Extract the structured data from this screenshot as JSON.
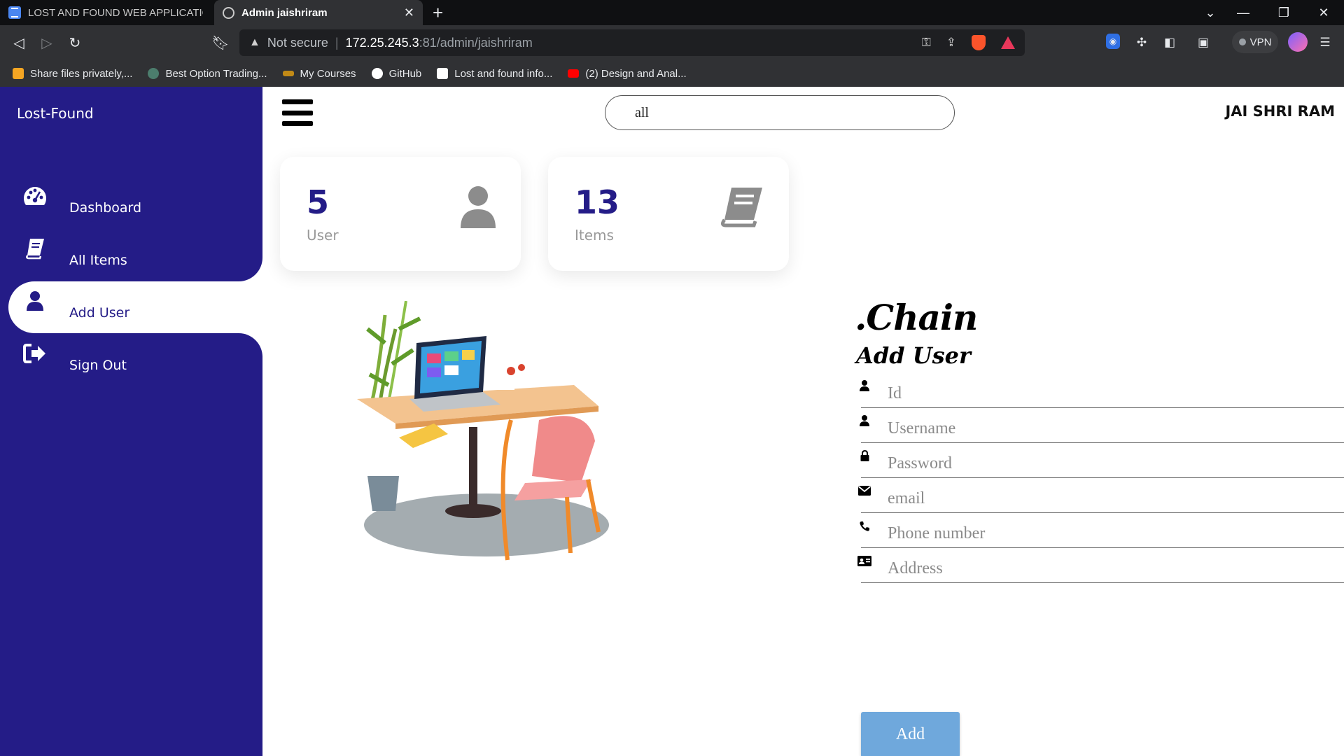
{
  "browser": {
    "tabs": [
      {
        "label": "LOST AND FOUND WEB APPLICATION",
        "active": false
      },
      {
        "label": "Admin jaishriram",
        "active": true
      }
    ],
    "address": {
      "security": "Not secure",
      "host": "172.25.245.3",
      "path": ":81/admin/jaishriram"
    },
    "vpn_label": "VPN",
    "bookmarks": [
      "Share files privately,...",
      "Best Option Trading...",
      "My Courses",
      "GitHub",
      "Lost and found info...",
      "(2) Design and Anal..."
    ]
  },
  "sidebar": {
    "brand": "Lost-Found",
    "items": [
      {
        "label": "Dashboard",
        "icon": "dashboard-icon"
      },
      {
        "label": "All Items",
        "icon": "book-icon"
      },
      {
        "label": "Add User",
        "icon": "user-icon",
        "active": true
      },
      {
        "label": "Sign Out",
        "icon": "sign-out-icon"
      }
    ]
  },
  "header": {
    "search_value": "all",
    "user_name": "JAI SHRI RAM"
  },
  "cards": [
    {
      "value": "5",
      "caption": "User",
      "icon": "user-icon"
    },
    {
      "value": "13",
      "caption": "Items",
      "icon": "book-icon"
    }
  ],
  "form": {
    "logo": ".Chain",
    "heading": "Add User",
    "fields": [
      {
        "placeholder": "Id",
        "icon": "user-icon"
      },
      {
        "placeholder": "Username",
        "icon": "user-icon"
      },
      {
        "placeholder": "Password",
        "icon": "lock-icon"
      },
      {
        "placeholder": "email",
        "icon": "envelope-icon"
      },
      {
        "placeholder": "Phone number",
        "icon": "phone-icon"
      },
      {
        "placeholder": "Address",
        "icon": "address-card-icon"
      }
    ],
    "submit_label": "Add"
  },
  "colors": {
    "sidebar": "#241c87",
    "accent": "#241c87",
    "button": "#6fa8dc"
  }
}
